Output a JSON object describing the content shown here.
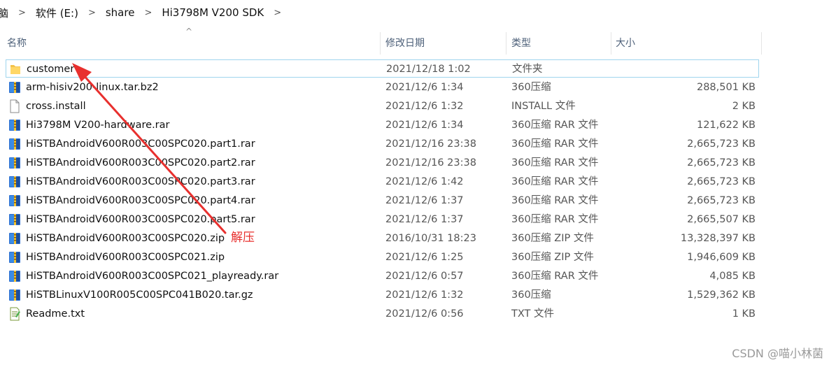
{
  "breadcrumb": [
    "脑",
    "软件 (E:)",
    "share",
    "Hi3798M V200 SDK"
  ],
  "columns": {
    "name": "名称",
    "date": "修改日期",
    "type": "类型",
    "size": "大小"
  },
  "files": [
    {
      "name": "customer",
      "date": "2021/12/18 1:02",
      "type": "文件夹",
      "size": "",
      "icon": "folder-icon"
    },
    {
      "name": "arm-hisiv200-linux.tar.bz2",
      "date": "2021/12/6 1:34",
      "type": "360压缩",
      "size": "288,501 KB",
      "icon": "archive-icon"
    },
    {
      "name": "cross.install",
      "date": "2021/12/6 1:32",
      "type": "INSTALL 文件",
      "size": "2 KB",
      "icon": "file-icon"
    },
    {
      "name": "Hi3798M V200-hardware.rar",
      "date": "2021/12/6 1:34",
      "type": "360压缩 RAR 文件",
      "size": "121,622 KB",
      "icon": "archive-icon"
    },
    {
      "name": "HiSTBAndroidV600R003C00SPC020.part1.rar",
      "date": "2021/12/16 23:38",
      "type": "360压缩 RAR 文件",
      "size": "2,665,723 KB",
      "icon": "archive-icon"
    },
    {
      "name": "HiSTBAndroidV600R003C00SPC020.part2.rar",
      "date": "2021/12/16 23:38",
      "type": "360压缩 RAR 文件",
      "size": "2,665,723 KB",
      "icon": "archive-icon"
    },
    {
      "name": "HiSTBAndroidV600R003C00SPC020.part3.rar",
      "date": "2021/12/6 1:42",
      "type": "360压缩 RAR 文件",
      "size": "2,665,723 KB",
      "icon": "archive-icon"
    },
    {
      "name": "HiSTBAndroidV600R003C00SPC020.part4.rar",
      "date": "2021/12/6 1:37",
      "type": "360压缩 RAR 文件",
      "size": "2,665,723 KB",
      "icon": "archive-icon"
    },
    {
      "name": "HiSTBAndroidV600R003C00SPC020.part5.rar",
      "date": "2021/12/6 1:37",
      "type": "360压缩 RAR 文件",
      "size": "2,665,507 KB",
      "icon": "archive-icon"
    },
    {
      "name": "HiSTBAndroidV600R003C00SPC020.zip",
      "date": "2016/10/31 18:23",
      "type": "360压缩 ZIP 文件",
      "size": "13,328,397 KB",
      "icon": "archive-icon"
    },
    {
      "name": "HiSTBAndroidV600R003C00SPC021.zip",
      "date": "2021/12/6 1:25",
      "type": "360压缩 ZIP 文件",
      "size": "1,946,609 KB",
      "icon": "archive-icon"
    },
    {
      "name": "HiSTBAndroidV600R003C00SPC021_playready.rar",
      "date": "2021/12/6 0:57",
      "type": "360压缩 RAR 文件",
      "size": "4,085 KB",
      "icon": "archive-icon"
    },
    {
      "name": "HiSTBLinuxV100R005C00SPC041B020.tar.gz",
      "date": "2021/12/6 1:32",
      "type": "360压缩",
      "size": "1,529,362 KB",
      "icon": "archive-icon"
    },
    {
      "name": "Readme.txt",
      "date": "2021/12/6 0:56",
      "type": "TXT 文件",
      "size": "1 KB",
      "icon": "text-file-icon"
    }
  ],
  "annotation": {
    "label": "解压",
    "color": "#e8302e"
  },
  "watermark": "CSDN @喵小林菌",
  "colors": {
    "selection_border": "#9fd5ee",
    "header_text": "#4d6079"
  }
}
